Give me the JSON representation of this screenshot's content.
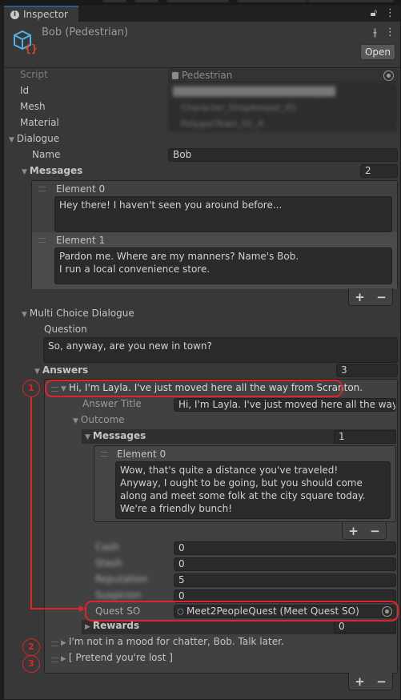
{
  "tab": {
    "label": "Inspector",
    "icon": "info-icon"
  },
  "header": {
    "title": "Bob (Pedestrian)",
    "open_button": "Open"
  },
  "fields": {
    "script": {
      "label": "Script",
      "value": "Pedestrian"
    },
    "id": {
      "label": "Id",
      "value": "████████████████████████"
    },
    "mesh": {
      "label": "Mesh",
      "value": "Character_Shopkeeper_01"
    },
    "material": {
      "label": "Material",
      "value": "PolygonTown_01_A"
    }
  },
  "dialogue": {
    "label": "Dialogue",
    "name_label": "Name",
    "name_value": "Bob",
    "messages_label": "Messages",
    "messages_count": "2",
    "messages": [
      {
        "label": "Element 0",
        "text": "Hey there! I haven't seen you around before..."
      },
      {
        "label": "Element 1",
        "text": "Pardon me. Where are my manners? Name's Bob.\nI run a local convenience store."
      }
    ]
  },
  "multi_choice": {
    "label": "Multi Choice Dialogue",
    "question_label": "Question",
    "question_value": "So, anyway, are you new in town?",
    "answers_label": "Answers",
    "answers_count": "3",
    "answers": [
      {
        "title": "Hi, I'm Layla. I've just moved here all the way from Scranton.",
        "answer_title_label": "Answer Title",
        "answer_title_value": "Hi, I'm Layla. I've just moved here all the way from Scranton.",
        "outcome_label": "Outcome",
        "messages_label": "Messages",
        "messages_count": "1",
        "messages": [
          {
            "label": "Element 0",
            "text": "Wow, that's quite a distance you've traveled!\nAnyway, I ought to be going, but you should come along and meet some folk at the city square today.\nWe're a friendly bunch!"
          }
        ],
        "stats": [
          {
            "label": "Cash",
            "value": "0"
          },
          {
            "label": "Stash",
            "value": "0"
          },
          {
            "label": "Reputation",
            "value": "5"
          },
          {
            "label": "Suspicion",
            "value": "0"
          }
        ],
        "quest_label": "Quest SO",
        "quest_value": "Meet2PeopleQuest (Meet Quest SO)",
        "rewards_label": "Rewards",
        "rewards_count": "0"
      },
      {
        "title": "I'm not in a mood for chatter, Bob. Talk later."
      },
      {
        "title": "[ Pretend you're lost ]"
      }
    ]
  },
  "annotations": [
    "1",
    "2",
    "3"
  ],
  "colors": {
    "accent": "#2c5d87",
    "annotation": "#e0242b",
    "panel": "#383838",
    "field": "#2a2a2a"
  }
}
